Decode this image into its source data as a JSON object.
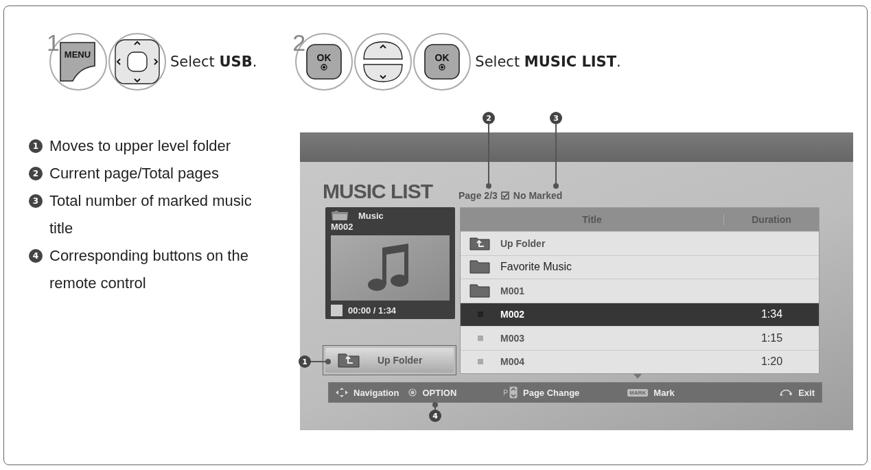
{
  "steps": [
    {
      "number": "1",
      "buttons": [
        {
          "kind": "menu",
          "label": "MENU"
        },
        {
          "kind": "dpad"
        }
      ],
      "text": "Select **USB**."
    },
    {
      "number": "2",
      "buttons": [
        {
          "kind": "ok",
          "label": "OK"
        },
        {
          "kind": "updown"
        },
        {
          "kind": "ok",
          "label": "OK"
        }
      ],
      "text": "Select **MUSIC LIST**."
    }
  ],
  "legend": [
    {
      "number": "1",
      "text": "Moves to upper level folder"
    },
    {
      "number": "2",
      "text": "Current page/Total pages"
    },
    {
      "number": "3",
      "text": "Total number of marked music title"
    },
    {
      "number": "4",
      "text": "Corresponding buttons on the remote control"
    }
  ],
  "screen": {
    "title": "MUSIC LIST",
    "page": "Page 2/3",
    "marked": "No Marked",
    "preview": {
      "folder": "Music",
      "track": "M002",
      "time": "00:00 / 1:34"
    },
    "up_button": "Up Folder",
    "columns": [
      "Title",
      "Duration"
    ],
    "rows": [
      {
        "kind": "up",
        "title": "Up Folder",
        "selected": false
      },
      {
        "kind": "folder",
        "title": "Favorite Music",
        "selected": false
      },
      {
        "kind": "folder",
        "title": "M001",
        "selected": false
      },
      {
        "kind": "file",
        "title": "M002",
        "duration": "1:34",
        "selected": true
      },
      {
        "kind": "file",
        "title": "M003",
        "duration": "1:15",
        "selected": false
      },
      {
        "kind": "file",
        "title": "M004",
        "duration": "1:20",
        "selected": false
      }
    ],
    "footer": [
      {
        "kind": "nav",
        "label": "Navigation"
      },
      {
        "kind": "option",
        "label": "OPTION"
      },
      {
        "kind": "page",
        "key": "P",
        "label": "Page Change"
      },
      {
        "kind": "mark",
        "key": "MARK",
        "label": "Mark"
      },
      {
        "kind": "exit",
        "label": "Exit"
      }
    ],
    "callouts": [
      "1",
      "2",
      "3",
      "4"
    ]
  }
}
